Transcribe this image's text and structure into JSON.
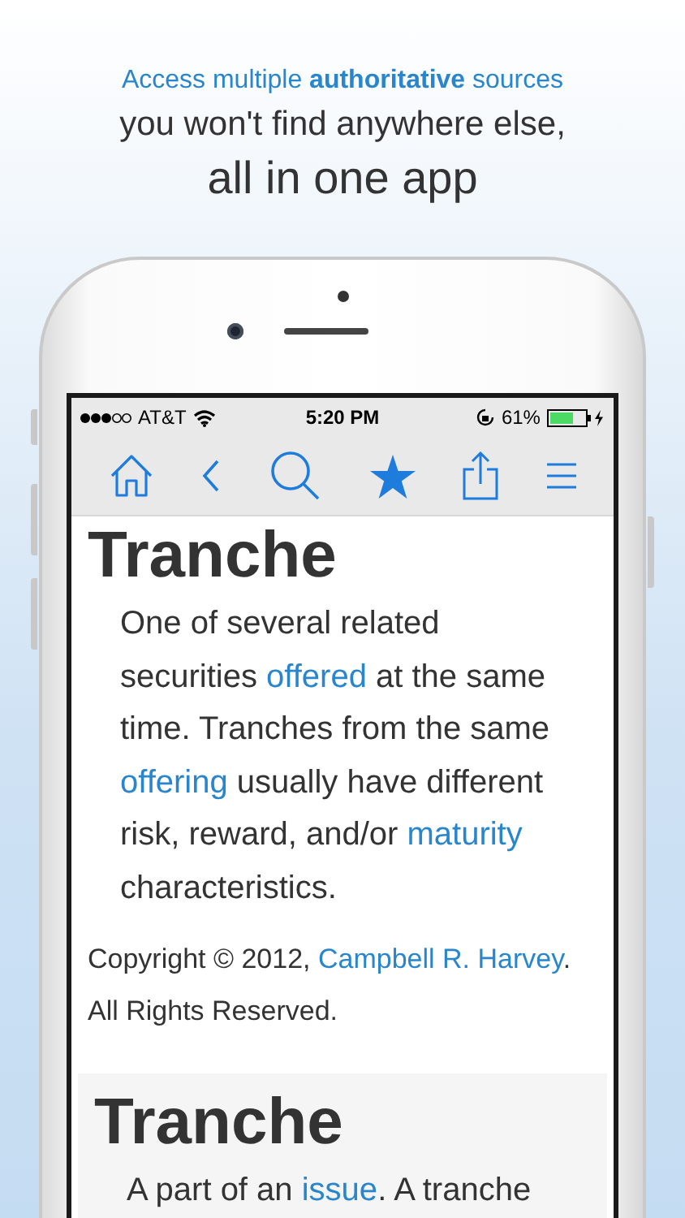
{
  "headline": {
    "line_1": "Access multiple **authoritative** sources",
    "line_2": "you won't find anywhere else,",
    "line_3": "all in one app"
  },
  "status_bar": {
    "carrier": "AT&T",
    "time": "5:20 PM",
    "battery": "61%"
  },
  "entries": [
    {
      "term": "Tranche",
      "shaded": false,
      "definition": [
        {
          "text": "One of several related securities ",
          "link": false
        },
        {
          "text": "offered",
          "link": true
        },
        {
          "text": " at the same time. Tranches from the same ",
          "link": false
        },
        {
          "text": "offering",
          "link": true
        },
        {
          "text": " usually have different risk, reward, and/or ",
          "link": false
        },
        {
          "text": "maturity",
          "link": true
        },
        {
          "text": " characteristics.",
          "link": false
        }
      ],
      "credit": [
        {
          "text": "Copyright © 2012, ",
          "link": false
        },
        {
          "text": "Campbell R. ",
          "link": true
        },
        {
          "text": "Harvey",
          "link": true
        },
        {
          "text": ". All Rights Reserved.",
          "link": false
        }
      ]
    },
    {
      "term": "Tranche",
      "shaded": true,
      "definition": [
        {
          "text": "A part of an ",
          "link": false
        },
        {
          "text": "issue",
          "link": true
        },
        {
          "text": ". A tranche",
          "link": false
        }
      ]
    }
  ]
}
